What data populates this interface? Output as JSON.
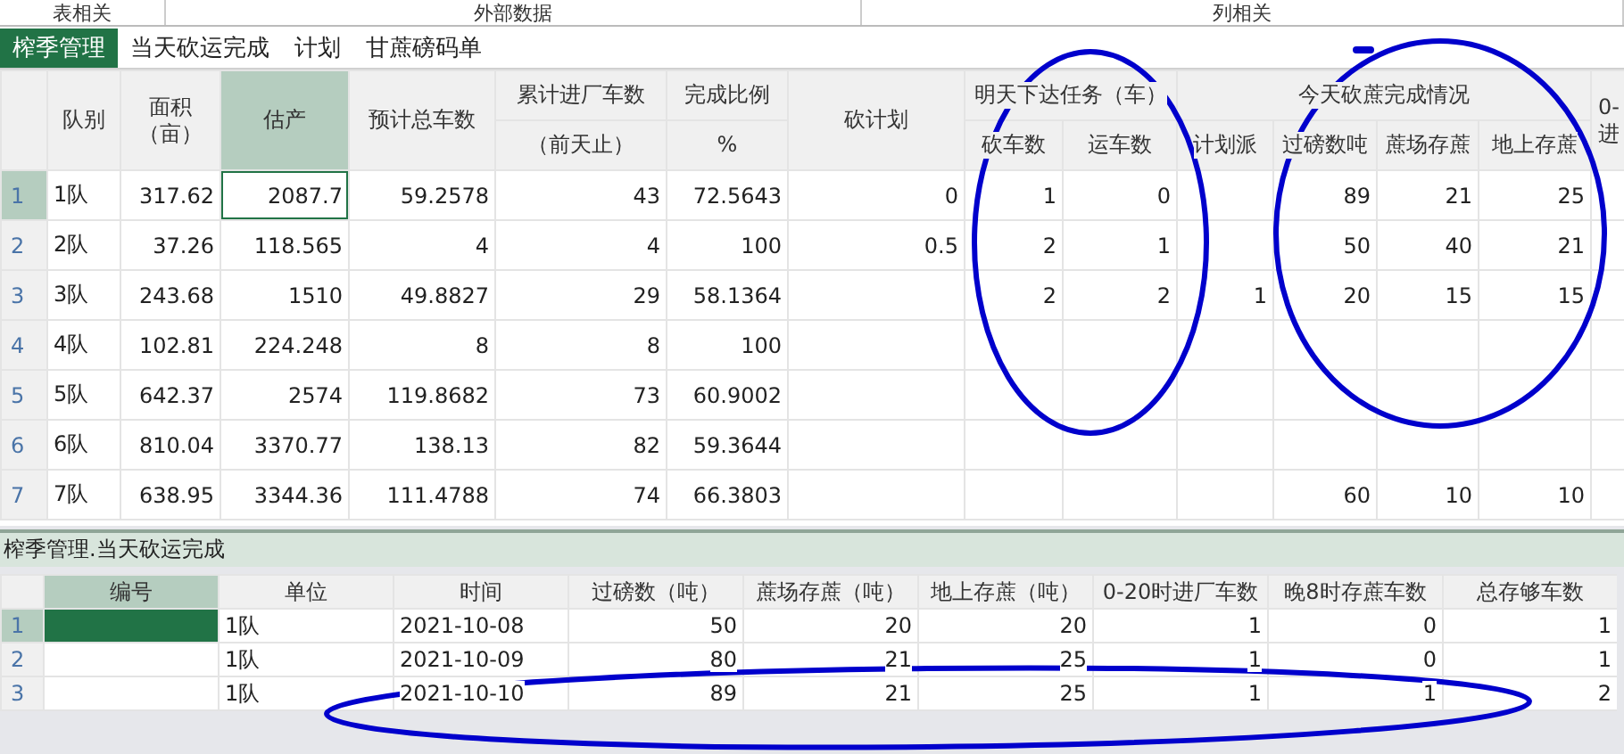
{
  "ribbon_groups": [
    "表相关",
    "外部数据",
    "列相关"
  ],
  "tabs": [
    {
      "label": "榨季管理",
      "selected": true
    },
    {
      "label": "当天砍运完成",
      "selected": false
    },
    {
      "label": "计划",
      "selected": false
    },
    {
      "label": "甘蔗磅码单",
      "selected": false
    }
  ],
  "upper_grid": {
    "header": [
      {
        "kind": "single",
        "label": "队别",
        "selected": false
      },
      {
        "kind": "single",
        "label": "面积（亩）",
        "selected": false
      },
      {
        "kind": "single",
        "label": "估产",
        "selected": true
      },
      {
        "kind": "single",
        "label": "预计总车数",
        "selected": false
      },
      {
        "kind": "split",
        "label": "累计进厂车数",
        "sub": "（前天止）",
        "selected": false
      },
      {
        "kind": "split",
        "label": "完成比例",
        "sub": "%",
        "selected": false
      },
      {
        "kind": "single",
        "label": "砍计划",
        "selected": false
      },
      {
        "kind": "group",
        "label": "明天下达任务（车）",
        "columns": [
          {
            "label": "砍车数",
            "selected": false
          },
          {
            "label": "运车数",
            "selected": false
          }
        ]
      },
      {
        "kind": "group",
        "label": "今天砍蔗完成情况",
        "columns": [
          {
            "label": "计划派",
            "selected": false
          },
          {
            "label": "过磅数吨",
            "selected": false
          },
          {
            "label": "蔗场存蔗",
            "selected": false
          },
          {
            "label": "地上存蔗",
            "selected": false
          }
        ]
      },
      {
        "kind": "single",
        "label": "0-进",
        "selected": false
      }
    ],
    "rows": [
      {
        "number": "1",
        "selected": true,
        "cells": [
          "1队",
          "317.62",
          "2087.7",
          "59.2578",
          "43",
          "72.5643",
          "0",
          "1",
          "0",
          null,
          "89",
          "21",
          "25",
          null
        ]
      },
      {
        "number": "2",
        "selected": false,
        "cells": [
          "2队",
          "37.26",
          "118.565",
          "4",
          "4",
          "100",
          "0.5",
          "2",
          "1",
          null,
          "50",
          "40",
          "21",
          null
        ]
      },
      {
        "number": "3",
        "selected": false,
        "cells": [
          "3队",
          "243.68",
          "1510",
          "49.8827",
          "29",
          "58.1364",
          null,
          "2",
          "2",
          "1",
          "20",
          "15",
          "15",
          null
        ]
      },
      {
        "number": "4",
        "selected": false,
        "cells": [
          "4队",
          "102.81",
          "224.248",
          "8",
          "8",
          "100",
          null,
          null,
          null,
          null,
          null,
          null,
          null,
          null
        ]
      },
      {
        "number": "5",
        "selected": false,
        "cells": [
          "5队",
          "642.37",
          "2574",
          "119.8682",
          "73",
          "60.9002",
          null,
          null,
          null,
          null,
          null,
          null,
          null,
          null
        ]
      },
      {
        "number": "6",
        "selected": false,
        "cells": [
          "6队",
          "810.04",
          "3370.77",
          "138.13",
          "82",
          "59.3644",
          null,
          null,
          null,
          null,
          null,
          null,
          null,
          null
        ]
      },
      {
        "number": "7",
        "selected": false,
        "cells": [
          "7队",
          "638.95",
          "3344.36",
          "111.4788",
          "74",
          "66.3803",
          null,
          null,
          null,
          null,
          "60",
          "10",
          "10",
          null
        ]
      }
    ]
  },
  "lower_panel": {
    "title": "榨季管理.当天砍运完成",
    "header": [
      {
        "kind": "single",
        "label": "编号",
        "selected": true
      },
      {
        "kind": "single",
        "label": "单位",
        "selected": false
      },
      {
        "kind": "single",
        "label": "时间",
        "selected": false
      },
      {
        "kind": "single",
        "label": "过磅数（吨）",
        "selected": false
      },
      {
        "kind": "single",
        "label": "蔗场存蔗（吨）",
        "selected": false
      },
      {
        "kind": "single",
        "label": "地上存蔗（吨）",
        "selected": false
      },
      {
        "kind": "single",
        "label": "0-20时进厂车数",
        "selected": false
      },
      {
        "kind": "single",
        "label": "晚8时存蔗车数",
        "selected": false
      },
      {
        "kind": "single",
        "label": "总存够车数",
        "selected": false
      }
    ],
    "rows": [
      {
        "number": "1",
        "selected": true,
        "cells": [
          null,
          "1队",
          "2021-10-08",
          "50",
          "20",
          "20",
          "1",
          "0",
          "1"
        ]
      },
      {
        "number": "2",
        "selected": false,
        "cells": [
          null,
          "1队",
          "2021-10-09",
          "80",
          "21",
          "25",
          "1",
          "0",
          "1"
        ]
      },
      {
        "number": "3",
        "selected": false,
        "cells": [
          null,
          "1队",
          "2021-10-10",
          "89",
          "21",
          "25",
          "1",
          "1",
          "2"
        ]
      }
    ]
  }
}
